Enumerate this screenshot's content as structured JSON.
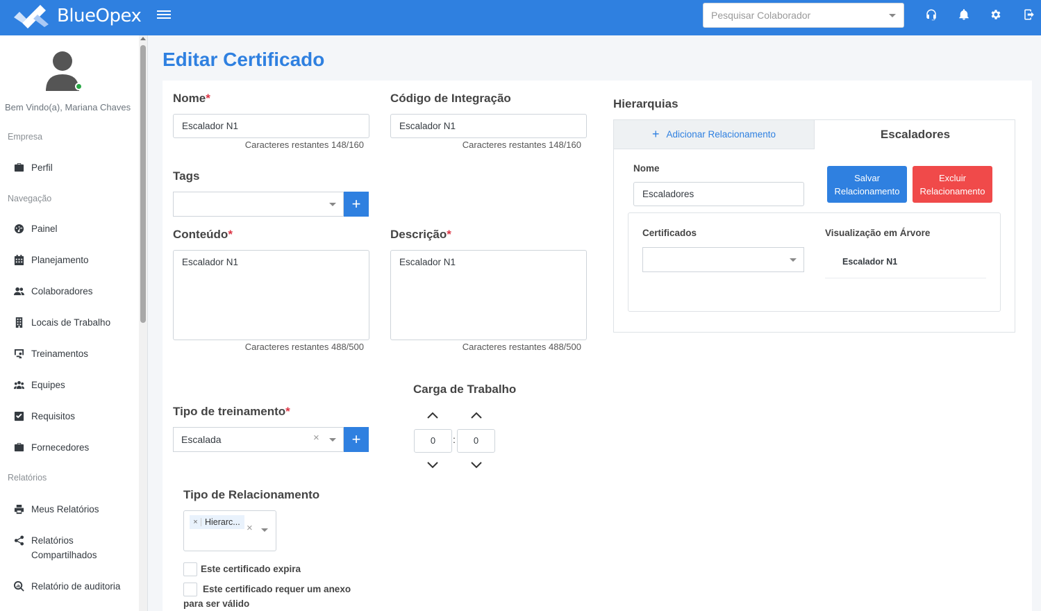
{
  "app": {
    "name": "BlueOpex"
  },
  "topbar": {
    "search_placeholder": "Pesquisar Colaborador"
  },
  "sidebar": {
    "welcome": "Bem Vindo(a), Mariana Chaves",
    "sections": {
      "empresa": "Empresa",
      "navegacao": "Navegação",
      "relatorios": "Relatórios"
    },
    "items": {
      "perfil": "Perfil",
      "painel": "Painel",
      "planejamento": "Planejamento",
      "colaboradores": "Colaboradores",
      "locais": "Locais de Trabalho",
      "treinamentos": "Treinamentos",
      "equipes": "Equipes",
      "requisitos": "Requisitos",
      "fornecedores": "Fornecedores",
      "meus_relatorios": "Meus Relatórios",
      "relatorios_compartilhados": "Relatórios Compartilhados",
      "relatorio_auditoria": "Relatório de auditoria"
    }
  },
  "page": {
    "title": "Editar Certificado"
  },
  "form": {
    "nome": {
      "label": "Nome",
      "value": "Escalador N1",
      "counter": "Caracteres restantes 148/160"
    },
    "codigo": {
      "label": "Código de Integração",
      "value": "Escalador N1",
      "counter": "Caracteres restantes 148/160"
    },
    "tags": {
      "label": "Tags",
      "value": ""
    },
    "conteudo": {
      "label": "Conteúdo",
      "value": "Escalador N1",
      "counter": "Caracteres restantes 488/500"
    },
    "descricao": {
      "label": "Descrição",
      "value": "Escalador N1",
      "counter": "Caracteres restantes 488/500"
    },
    "carga": {
      "label": "Carga de Trabalho",
      "hours": "0",
      "separator": ":",
      "minutes": "0"
    },
    "tipo_treinamento": {
      "label": "Tipo de treinamento",
      "value": "Escalada",
      "clear": "×"
    },
    "tipo_relacionamento": {
      "label": "Tipo de Relacionamento",
      "chip": "Hierarc...",
      "chip_remove": "×",
      "clear": "×"
    },
    "expira": {
      "label": "Este certificado expira",
      "checked": false
    },
    "anexo": {
      "label": "Este certificado requer um anexo para ser válido",
      "checked": false
    },
    "required_mark": "*",
    "plus": "+"
  },
  "hierarquias": {
    "title": "Hierarquias",
    "tab_add": "Adicionar Relacionamento",
    "tab_add_icon": "+",
    "tab_active": "Escaladores",
    "nome_label": "Nome",
    "nome_value": "Escaladores",
    "save_button": "Salvar Relacionamento",
    "delete_button": "Excluir Relacionamento",
    "certificados_label": "Certificados",
    "certificados_value": "",
    "tree_label": "Visualização em Árvore",
    "tree_items": [
      "Escalador N1"
    ]
  },
  "colors": {
    "primary": "#2f80e0",
    "danger": "#f04a4a",
    "online": "#28a745"
  }
}
